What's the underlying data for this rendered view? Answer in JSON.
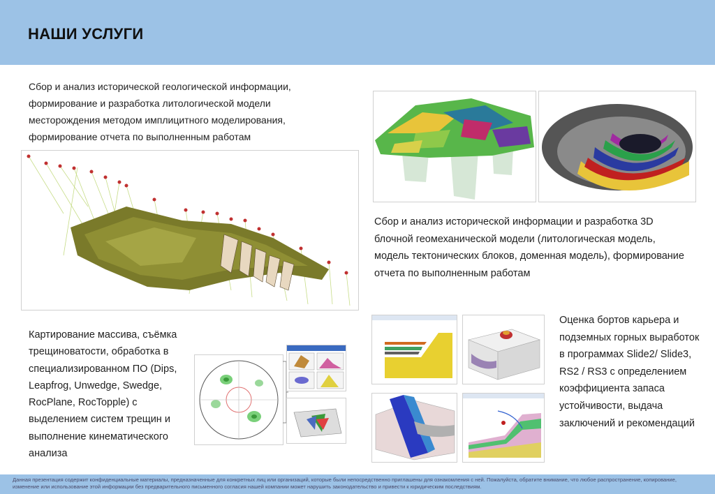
{
  "header": {
    "title": "НАШИ УСЛУГИ"
  },
  "services": [
    {
      "text": "Сбор и анализ исторической геологической информации, формирование и разработка литологической модели месторождения методом имплицитного моделирования, формирование отчета по выполненным работам"
    },
    {
      "text": "Сбор и анализ исторической информации и разработка 3D блочной геомеханической модели (литологическая модель, модель тектонических блоков, доменная модель), формирование отчета по выполненным работам"
    },
    {
      "text": "Картирование массива, съёмка трещиноватости, обработка в специализированном ПО (Dips, Leapfrog, Unwedge, Swedge, RocPlane, RocTopple) с выделением систем трещин и выполнение кинематического анализа"
    },
    {
      "text": "Оценка бортов карьера и подземных горных выработок в программах Slide2/ Slide3, RS2 / RS3 с определением коэффициента запаса устойчивости, выдача заключений и рекомендаций"
    }
  ],
  "footer": {
    "text": "Данная презентация содержит конфиденциальные материалы, предназначенные для конкретных лиц или организаций, которые были непосредственно приглашены для ознакомления с ней. Пожалуйста, обратите внимание, что любое распространение, копирование, изменение или использование этой информации без предварительного письменного согласия нашей компании может нарушить законодательство и привести к юридическим последствиям."
  },
  "colors": {
    "header_bg": "#9cc2e6",
    "footer_bg": "#9cc2e6",
    "footer_text": "#4a4a6a"
  }
}
